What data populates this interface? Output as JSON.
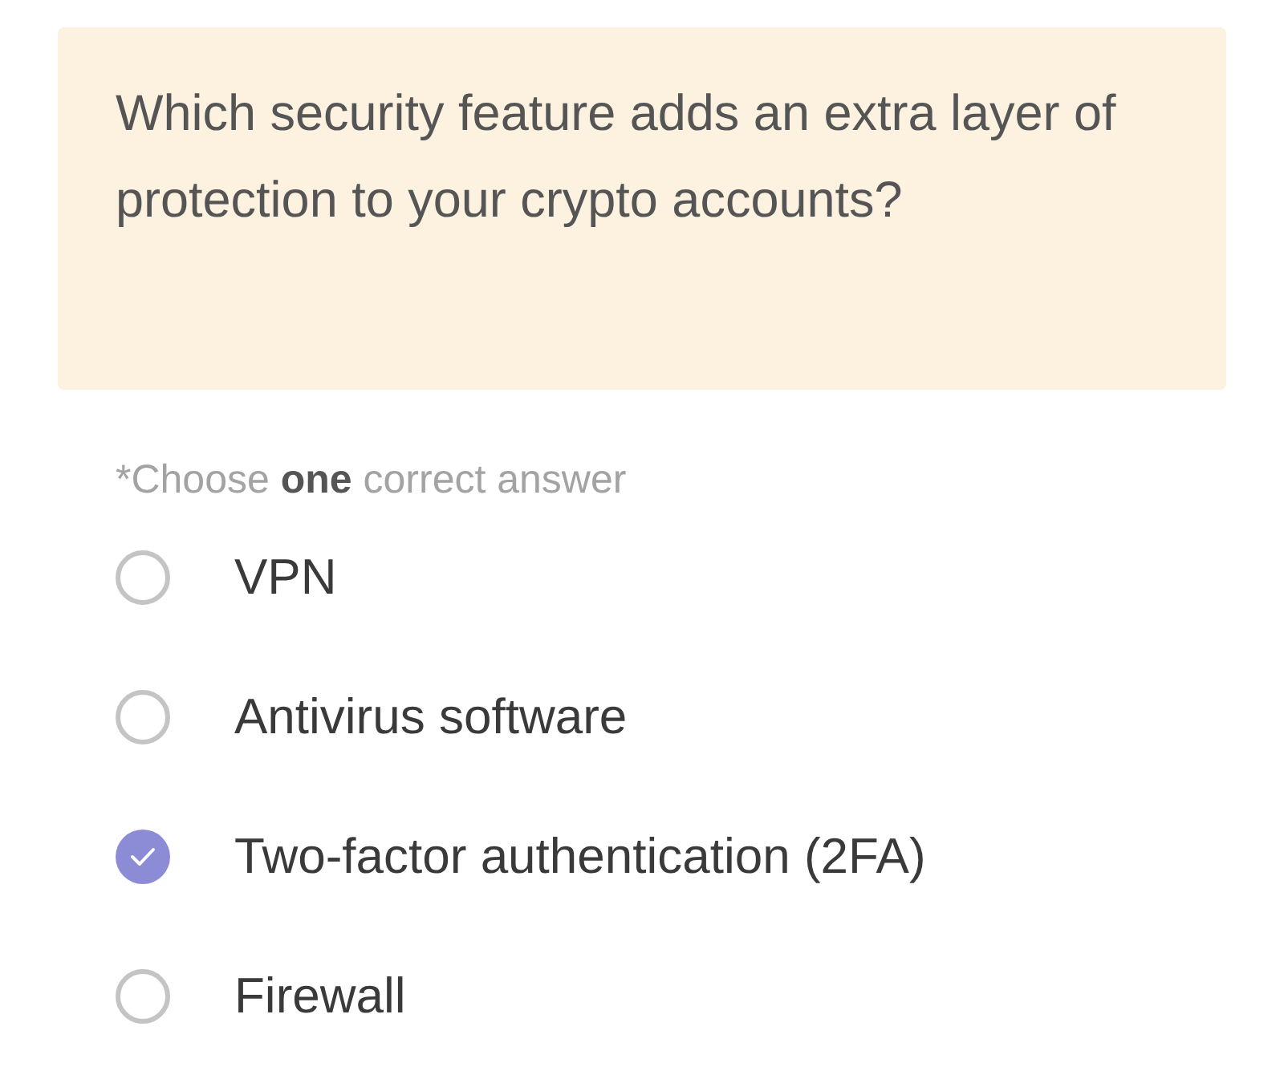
{
  "question": "Which security feature adds an extra layer of protection to your crypto accounts?",
  "hint": "*Choose **one** correct answer",
  "options": [
    {
      "label": "VPN",
      "selected": false
    },
    {
      "label": "Antivirus software",
      "selected": false
    },
    {
      "label": "Two-factor authentication (2FA)",
      "selected": true
    },
    {
      "label": "Firewall",
      "selected": false
    }
  ]
}
